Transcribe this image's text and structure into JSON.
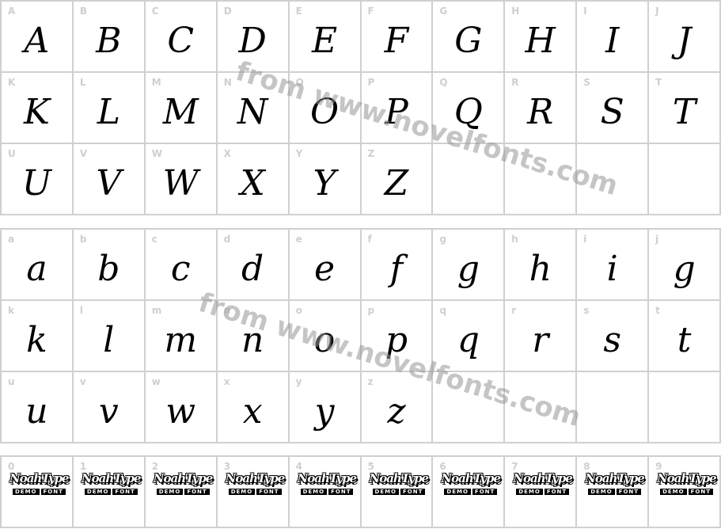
{
  "uppercase": [
    {
      "label": "A",
      "glyph": "A"
    },
    {
      "label": "B",
      "glyph": "B"
    },
    {
      "label": "C",
      "glyph": "C"
    },
    {
      "label": "D",
      "glyph": "D"
    },
    {
      "label": "E",
      "glyph": "E"
    },
    {
      "label": "F",
      "glyph": "F"
    },
    {
      "label": "G",
      "glyph": "G"
    },
    {
      "label": "H",
      "glyph": "H"
    },
    {
      "label": "I",
      "glyph": "I"
    },
    {
      "label": "J",
      "glyph": "J"
    },
    {
      "label": "K",
      "glyph": "K"
    },
    {
      "label": "L",
      "glyph": "L"
    },
    {
      "label": "M",
      "glyph": "M"
    },
    {
      "label": "N",
      "glyph": "N"
    },
    {
      "label": "O",
      "glyph": "O"
    },
    {
      "label": "P",
      "glyph": "P"
    },
    {
      "label": "Q",
      "glyph": "Q"
    },
    {
      "label": "R",
      "glyph": "R"
    },
    {
      "label": "S",
      "glyph": "S"
    },
    {
      "label": "T",
      "glyph": "T"
    },
    {
      "label": "U",
      "glyph": "U"
    },
    {
      "label": "V",
      "glyph": "V"
    },
    {
      "label": "W",
      "glyph": "W"
    },
    {
      "label": "X",
      "glyph": "X"
    },
    {
      "label": "Y",
      "glyph": "Y"
    },
    {
      "label": "Z",
      "glyph": "Z"
    },
    {
      "label": "",
      "glyph": ""
    },
    {
      "label": "",
      "glyph": ""
    },
    {
      "label": "",
      "glyph": ""
    },
    {
      "label": "",
      "glyph": ""
    }
  ],
  "lowercase": [
    {
      "label": "a",
      "glyph": "a"
    },
    {
      "label": "b",
      "glyph": "b"
    },
    {
      "label": "c",
      "glyph": "c"
    },
    {
      "label": "d",
      "glyph": "d"
    },
    {
      "label": "e",
      "glyph": "e"
    },
    {
      "label": "f",
      "glyph": "f"
    },
    {
      "label": "g",
      "glyph": "g"
    },
    {
      "label": "h",
      "glyph": "h"
    },
    {
      "label": "i",
      "glyph": "i"
    },
    {
      "label": "j",
      "glyph": "g"
    },
    {
      "label": "k",
      "glyph": "k"
    },
    {
      "label": "l",
      "glyph": "l"
    },
    {
      "label": "m",
      "glyph": "m"
    },
    {
      "label": "n",
      "glyph": "n"
    },
    {
      "label": "o",
      "glyph": "o"
    },
    {
      "label": "p",
      "glyph": "p"
    },
    {
      "label": "q",
      "glyph": "q"
    },
    {
      "label": "r",
      "glyph": "r"
    },
    {
      "label": "s",
      "glyph": "s"
    },
    {
      "label": "t",
      "glyph": "t"
    },
    {
      "label": "u",
      "glyph": "u"
    },
    {
      "label": "v",
      "glyph": "v"
    },
    {
      "label": "w",
      "glyph": "w"
    },
    {
      "label": "x",
      "glyph": "x"
    },
    {
      "label": "y",
      "glyph": "y"
    },
    {
      "label": "z",
      "glyph": "z"
    },
    {
      "label": "",
      "glyph": ""
    },
    {
      "label": "",
      "glyph": ""
    },
    {
      "label": "",
      "glyph": ""
    },
    {
      "label": "",
      "glyph": ""
    }
  ],
  "digits": [
    {
      "label": "0"
    },
    {
      "label": "1"
    },
    {
      "label": "2"
    },
    {
      "label": "3"
    },
    {
      "label": "4"
    },
    {
      "label": "5"
    },
    {
      "label": "6"
    },
    {
      "label": "7"
    },
    {
      "label": "8"
    },
    {
      "label": "9"
    }
  ],
  "demo_glyph": {
    "logo": "NoahType",
    "tag1": "DEMO",
    "tag2": "FONT"
  },
  "watermark": "from www.novelfonts.com",
  "colors": {
    "grid": "#d0d0d0",
    "label": "#cfcfcf",
    "glyph": "#000000",
    "watermark": "#969696"
  }
}
